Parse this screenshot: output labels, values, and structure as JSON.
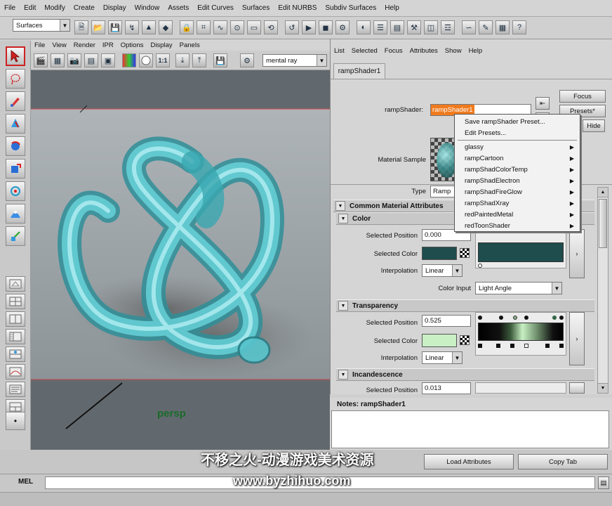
{
  "menubar": [
    "File",
    "Edit",
    "Modify",
    "Create",
    "Display",
    "Window",
    "Assets",
    "Edit Curves",
    "Surfaces",
    "Edit NURBS",
    "Subdiv Surfaces",
    "Help"
  ],
  "shelf": {
    "mode": "Surfaces"
  },
  "panel": {
    "menu": [
      "File",
      "View",
      "Render",
      "IPR",
      "Options",
      "Display",
      "Panels"
    ],
    "ratio": "1:1",
    "renderer": "mental ray",
    "camera_label": "persp"
  },
  "attribute_editor": {
    "menu": [
      "List",
      "Selected",
      "Focus",
      "Attributes",
      "Show",
      "Help"
    ],
    "tab": "rampShader1",
    "node_label": "rampShader:",
    "node_name": "rampShader1",
    "focus_btn": "Focus",
    "presets_btn": "Presets*",
    "hide_btn": "Hide",
    "material_sample_label": "Material Sample",
    "type_label": "Type",
    "type_value": "Ramp",
    "sections": {
      "common": "Common Material Attributes",
      "color": "Color",
      "transparency": "Transparency",
      "incandescence": "Incandescence"
    },
    "color": {
      "selected_position_label": "Selected Position",
      "selected_position": "0.000",
      "selected_color_label": "Selected Color",
      "interpolation_label": "Interpolation",
      "interpolation": "Linear",
      "color_input_label": "Color Input",
      "color_input": "Light Angle",
      "swatch": "#1f4c4c"
    },
    "transparency": {
      "selected_position_label": "Selected Position",
      "selected_position": "0.525",
      "selected_color_label": "Selected Color",
      "interpolation_label": "Interpolation",
      "interpolation": "Linear",
      "swatch": "#c8f0c4"
    },
    "incandescence": {
      "selected_position_label": "Selected Position",
      "selected_position": "0.013"
    }
  },
  "presets_menu": {
    "actions": [
      "Save rampShader Preset...",
      "Edit Presets..."
    ],
    "items": [
      "glassy",
      "rampCartoon",
      "rampShadColorTemp",
      "rampShadElectron",
      "rampShadFireGlow",
      "rampShadXray",
      "redPaintedMetal",
      "redToonShader"
    ]
  },
  "notes": {
    "label": "Notes:  rampShader1"
  },
  "bottom_buttons": {
    "load": "Load Attributes",
    "copy": "Copy Tab"
  },
  "mel": {
    "label": "MEL"
  },
  "watermark": {
    "cn": "不移之火-动漫游戏美术资源",
    "url": "www.byzhihuo.com"
  },
  "colors": {
    "accent_field": "#f07b1e",
    "viewport_bg": "#616a70",
    "knot": "#49c8cf"
  }
}
